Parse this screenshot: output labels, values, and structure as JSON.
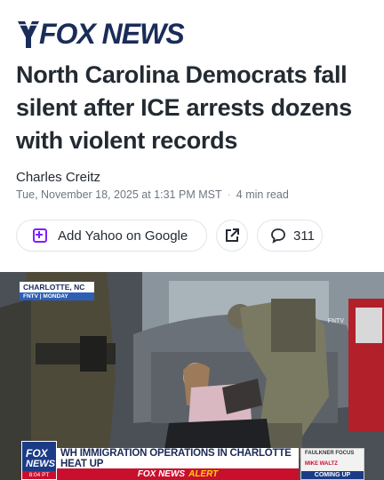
{
  "header": {
    "logo_text": "FOX NEWS",
    "logo_icon": "fox-news-logo",
    "brand_color": "#1a2c58"
  },
  "article": {
    "headline": "North Carolina Democrats fall silent after ICE arrests dozens with violent records",
    "author": "Charles Creitz",
    "date": "Tue, November 18, 2025 at 1:31 PM MST",
    "separator": "·",
    "read_time": "4 min read"
  },
  "actions": {
    "add_source_label": "Add Yahoo on Google",
    "add_source_icon": "plus-square-icon",
    "share_icon": "share-icon",
    "comments_icon": "comment-icon",
    "comments_count": "311",
    "accent_color": "#7e1fff"
  },
  "photo": {
    "location_tag": "CHARLOTTE, NC",
    "location_sub": "FNTV | MONDAY",
    "bug": "FNTV",
    "chyron": {
      "logo_line1": "FOX",
      "logo_line2": "NEWS",
      "time": "8:04 PT",
      "headline": "WH IMMIGRATION OPERATIONS IN CHARLOTTE HEAT UP",
      "alert_part1": "FOX NEWS",
      "alert_part2": "ALERT",
      "next_show": "FAULKNER FOCUS",
      "next_guest": "MIKE WALTZ",
      "coming_up": "COMING UP",
      "alert_color": "#c8102e",
      "navy_color": "#1b3b86"
    }
  }
}
